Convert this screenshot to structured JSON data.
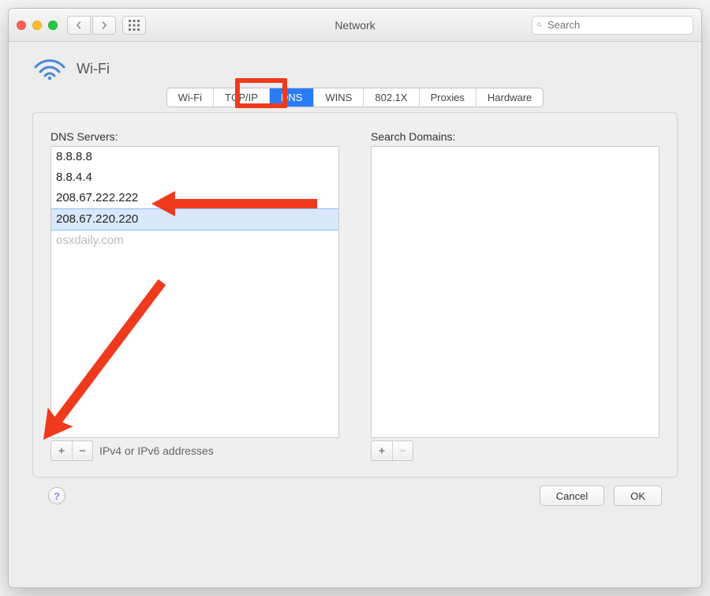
{
  "titlebar": {
    "title": "Network",
    "search_placeholder": "Search"
  },
  "header": {
    "connection_name": "Wi-Fi"
  },
  "tabs": {
    "items": [
      "Wi-Fi",
      "TCP/IP",
      "DNS",
      "WINS",
      "802.1X",
      "Proxies",
      "Hardware"
    ],
    "active_index": 2
  },
  "dns": {
    "label": "DNS Servers:",
    "servers": [
      "8.8.8.8",
      "8.8.4.4",
      "208.67.222.222",
      "208.67.220.220"
    ],
    "selected_index": 3,
    "watermark": "osxdaily.com",
    "hint": "IPv4 or IPv6 addresses"
  },
  "search_domains": {
    "label": "Search Domains:",
    "items": []
  },
  "footer": {
    "help_label": "?",
    "cancel": "Cancel",
    "ok": "OK"
  },
  "icons": {
    "plus": "+",
    "minus": "−"
  }
}
